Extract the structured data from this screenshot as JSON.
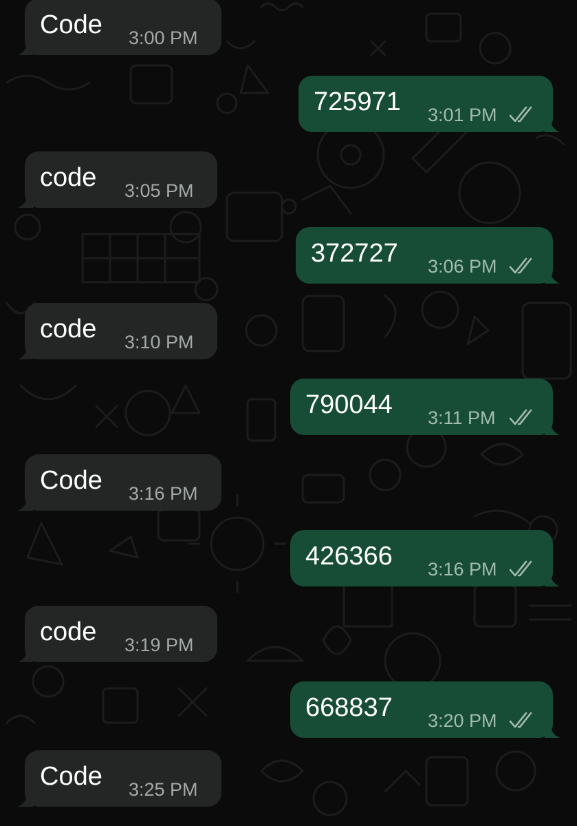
{
  "chat": {
    "messages": [
      {
        "direction": "in",
        "text": "Code",
        "time": "3:00 PM"
      },
      {
        "direction": "out",
        "text": "725971",
        "time": "3:01 PM",
        "status_icon": "read-double-check-icon"
      },
      {
        "direction": "in",
        "text": "code",
        "time": "3:05 PM"
      },
      {
        "direction": "out",
        "text": "372727",
        "time": "3:06 PM",
        "status_icon": "read-double-check-icon"
      },
      {
        "direction": "in",
        "text": "code",
        "time": "3:10 PM"
      },
      {
        "direction": "out",
        "text": "790044",
        "time": "3:11 PM",
        "status_icon": "read-double-check-icon"
      },
      {
        "direction": "in",
        "text": "Code",
        "time": "3:16 PM"
      },
      {
        "direction": "out",
        "text": "426366",
        "time": "3:16 PM",
        "status_icon": "read-double-check-icon"
      },
      {
        "direction": "in",
        "text": "code",
        "time": "3:19 PM"
      },
      {
        "direction": "out",
        "text": "668837",
        "time": "3:20 PM",
        "status_icon": "read-double-check-icon"
      },
      {
        "direction": "in",
        "text": "Code",
        "time": "3:25 PM"
      }
    ]
  },
  "colors": {
    "background": "#0b0b0b",
    "incoming_bubble": "#242626",
    "outgoing_bubble": "#174c36",
    "text": "#ffffff",
    "timestamp": "#a4a9a8"
  }
}
